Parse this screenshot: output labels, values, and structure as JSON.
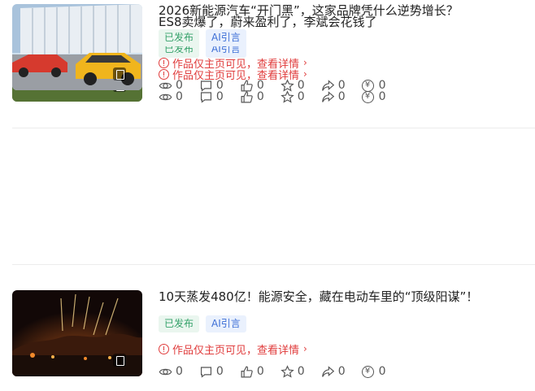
{
  "articles": [
    {
      "title": "ES8卖爆了，蔚来盈利了，李斌会花钱了",
      "tags": [
        "已发布",
        "AI引言"
      ],
      "notice": "作品仅主页可见，查看详情",
      "stats": {
        "views": "0",
        "comments": "0",
        "likes": "0",
        "favorites": "0",
        "shares": "0",
        "earnings": "0"
      }
    },
    {
      "title": "10天蒸发480亿！能源安全，藏在电动车里的“顶级阳谋”！",
      "tags": [
        "已发布",
        "AI引言"
      ],
      "notice": "作品仅主页可见，查看详情",
      "stats": {
        "views": "0",
        "comments": "0",
        "likes": "0",
        "favorites": "0",
        "shares": "0",
        "earnings": "0"
      }
    },
    {
      "title": "2026新能源汽车“开门黑”，这家品牌凭什么逆势增长？",
      "tags": [
        "已发布",
        "AI引言"
      ],
      "notice": "作品仅主页可见，查看详情",
      "stats": {
        "views": "0",
        "comments": "0",
        "likes": "0",
        "favorites": "0",
        "shares": "0",
        "earnings": "0"
      }
    }
  ],
  "icons": {
    "notice": "warning-circle-icon",
    "detail": "chevron-right-icon",
    "views": "eye-icon",
    "comments": "comment-icon",
    "likes": "thumbs-up-icon",
    "favorites": "star-icon",
    "shares": "share-icon",
    "earnings": "yen-icon"
  },
  "colors": {
    "notice": "#e03c3c",
    "tag_published": "#37a26b",
    "tag_ai": "#3d6fd6"
  }
}
